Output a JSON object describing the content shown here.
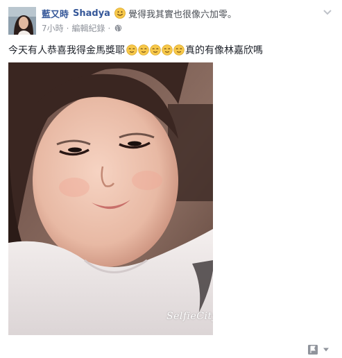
{
  "post": {
    "author": "藍又時",
    "feeling_prefix": "Shadya",
    "feeling_text": "覺得我其實也很像六加零。",
    "timestamp": "7小時",
    "edited_label": "編輯紀錄",
    "separator": "·",
    "message_before": "今天有人恭喜我得金馬獎耶",
    "message_after": "真的有像林嘉欣嗎",
    "emoji_count_label": "5",
    "photo_watermark": "SelfieCity!"
  },
  "icons": {
    "feeling": "smiley-face-icon",
    "privacy": "globe-icon",
    "options": "chevron-down-icon",
    "emoji": "relieved-face-icon",
    "page": "page-icon",
    "dropdown": "caret-down-icon"
  },
  "colors": {
    "name_link": "#365899",
    "meta_gray": "#90949c",
    "body_text": "#1d2129",
    "emoji_yellow": "#f7c84a"
  }
}
